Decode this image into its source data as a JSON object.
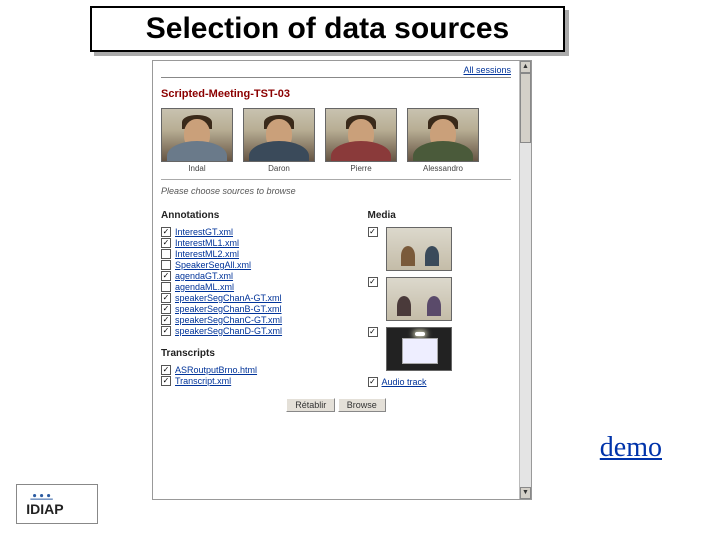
{
  "slide": {
    "title": "Selection of data sources",
    "demo_link": "demo"
  },
  "page": {
    "all_sessions": "All sessions",
    "session_title": "Scripted-Meeting-TST-03",
    "people": [
      {
        "name": "Indal"
      },
      {
        "name": "Daron"
      },
      {
        "name": "Pierre"
      },
      {
        "name": "Alessandro"
      }
    ],
    "instruction": "Please choose sources to browse",
    "sections": {
      "annotations_title": "Annotations",
      "annotations": [
        {
          "checked": true,
          "label": "InterestGT.xml"
        },
        {
          "checked": true,
          "label": "InterestML1.xml"
        },
        {
          "checked": false,
          "label": "InterestML2.xml"
        },
        {
          "checked": false,
          "label": "SpeakerSegAll.xml"
        },
        {
          "checked": true,
          "label": "agendaGT.xml"
        },
        {
          "checked": false,
          "label": "agendaML.xml"
        },
        {
          "checked": true,
          "label": "speakerSegChanA-GT.xml"
        },
        {
          "checked": true,
          "label": "speakerSegChanB-GT.xml"
        },
        {
          "checked": true,
          "label": "speakerSegChanC-GT.xml"
        },
        {
          "checked": true,
          "label": "speakerSegChanD-GT.xml"
        }
      ],
      "transcripts_title": "Transcripts",
      "transcripts": [
        {
          "checked": true,
          "label": "ASRoutputBrno.html"
        },
        {
          "checked": true,
          "label": "Transcript.xml"
        }
      ],
      "media_title": "Media",
      "media": [
        {
          "checked": true,
          "thumb": "m1"
        },
        {
          "checked": true,
          "thumb": "m2"
        },
        {
          "checked": true,
          "thumb": "m3"
        }
      ],
      "audio": {
        "checked": true,
        "label": "Audio track"
      }
    },
    "buttons": {
      "reset": "Rétablir",
      "browse": "Browse"
    }
  },
  "logo": {
    "text": "IDIAP"
  }
}
